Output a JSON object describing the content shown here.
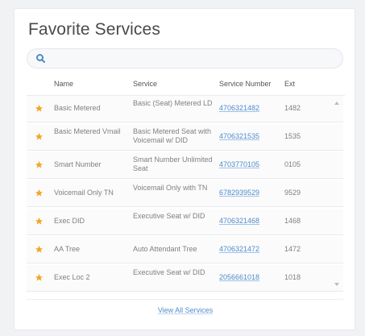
{
  "widget": {
    "title": "Favorite Services",
    "search": {
      "placeholder": "",
      "value": ""
    },
    "columns": {
      "name": "Name",
      "service": "Service",
      "service_number": "Service Number",
      "ext": "Ext"
    },
    "rows": [
      {
        "name": "Basic Metered",
        "service": "Basic (Seat) Metered LD",
        "number": "4706321482",
        "ext": "1482"
      },
      {
        "name": "Basic Metered Vmail",
        "service": "Basic Metered Seat with Voicemail w/ DID",
        "number": "4706321535",
        "ext": "1535"
      },
      {
        "name": "Smart Number",
        "service": "Smart Number Unlimited Seat",
        "number": "4703770105",
        "ext": "0105"
      },
      {
        "name": "Voicemail Only TN",
        "service": "Voicemail Only with TN",
        "number": "6782939529",
        "ext": "9529"
      },
      {
        "name": "Exec DID",
        "service": "Executive Seat w/ DID",
        "number": "4706321468",
        "ext": "1468"
      },
      {
        "name": "AA Tree",
        "service": "Auto Attendant Tree",
        "number": "4706321472",
        "ext": "1472"
      },
      {
        "name": "Exec Loc 2",
        "service": "Executive Seat w/ DID",
        "number": "2056661018",
        "ext": "1018"
      }
    ],
    "footer_link": "View All Services"
  },
  "colors": {
    "accent": "#4f8bc9",
    "star": "#f5a623",
    "background": "#f1f2f4"
  },
  "icons": {
    "search": "search-icon",
    "favorite": "star-icon",
    "scroll_up": "scroll-up-icon",
    "scroll_down": "scroll-down-icon"
  }
}
